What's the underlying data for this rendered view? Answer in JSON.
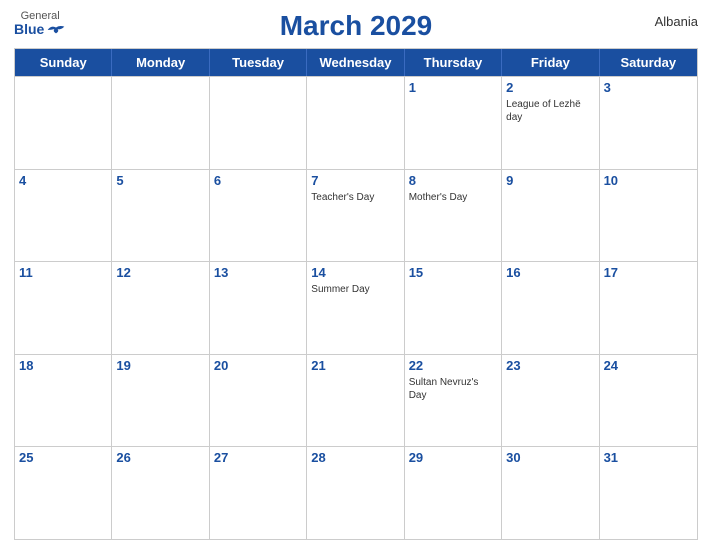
{
  "header": {
    "title": "March 2029",
    "country": "Albania",
    "logo": {
      "general": "General",
      "blue": "Blue"
    }
  },
  "dayHeaders": [
    "Sunday",
    "Monday",
    "Tuesday",
    "Wednesday",
    "Thursday",
    "Friday",
    "Saturday"
  ],
  "weeks": [
    [
      {
        "num": "",
        "holiday": ""
      },
      {
        "num": "",
        "holiday": ""
      },
      {
        "num": "",
        "holiday": ""
      },
      {
        "num": "",
        "holiday": ""
      },
      {
        "num": "1",
        "holiday": ""
      },
      {
        "num": "2",
        "holiday": "League of Lezhë day"
      },
      {
        "num": "3",
        "holiday": ""
      }
    ],
    [
      {
        "num": "4",
        "holiday": ""
      },
      {
        "num": "5",
        "holiday": ""
      },
      {
        "num": "6",
        "holiday": ""
      },
      {
        "num": "7",
        "holiday": "Teacher's Day"
      },
      {
        "num": "8",
        "holiday": "Mother's Day"
      },
      {
        "num": "9",
        "holiday": ""
      },
      {
        "num": "10",
        "holiday": ""
      }
    ],
    [
      {
        "num": "11",
        "holiday": ""
      },
      {
        "num": "12",
        "holiday": ""
      },
      {
        "num": "13",
        "holiday": ""
      },
      {
        "num": "14",
        "holiday": "Summer Day"
      },
      {
        "num": "15",
        "holiday": ""
      },
      {
        "num": "16",
        "holiday": ""
      },
      {
        "num": "17",
        "holiday": ""
      }
    ],
    [
      {
        "num": "18",
        "holiday": ""
      },
      {
        "num": "19",
        "holiday": ""
      },
      {
        "num": "20",
        "holiday": ""
      },
      {
        "num": "21",
        "holiday": ""
      },
      {
        "num": "22",
        "holiday": "Sultan Nevruz's Day"
      },
      {
        "num": "23",
        "holiday": ""
      },
      {
        "num": "24",
        "holiday": ""
      }
    ],
    [
      {
        "num": "25",
        "holiday": ""
      },
      {
        "num": "26",
        "holiday": ""
      },
      {
        "num": "27",
        "holiday": ""
      },
      {
        "num": "28",
        "holiday": ""
      },
      {
        "num": "29",
        "holiday": ""
      },
      {
        "num": "30",
        "holiday": ""
      },
      {
        "num": "31",
        "holiday": ""
      }
    ]
  ]
}
